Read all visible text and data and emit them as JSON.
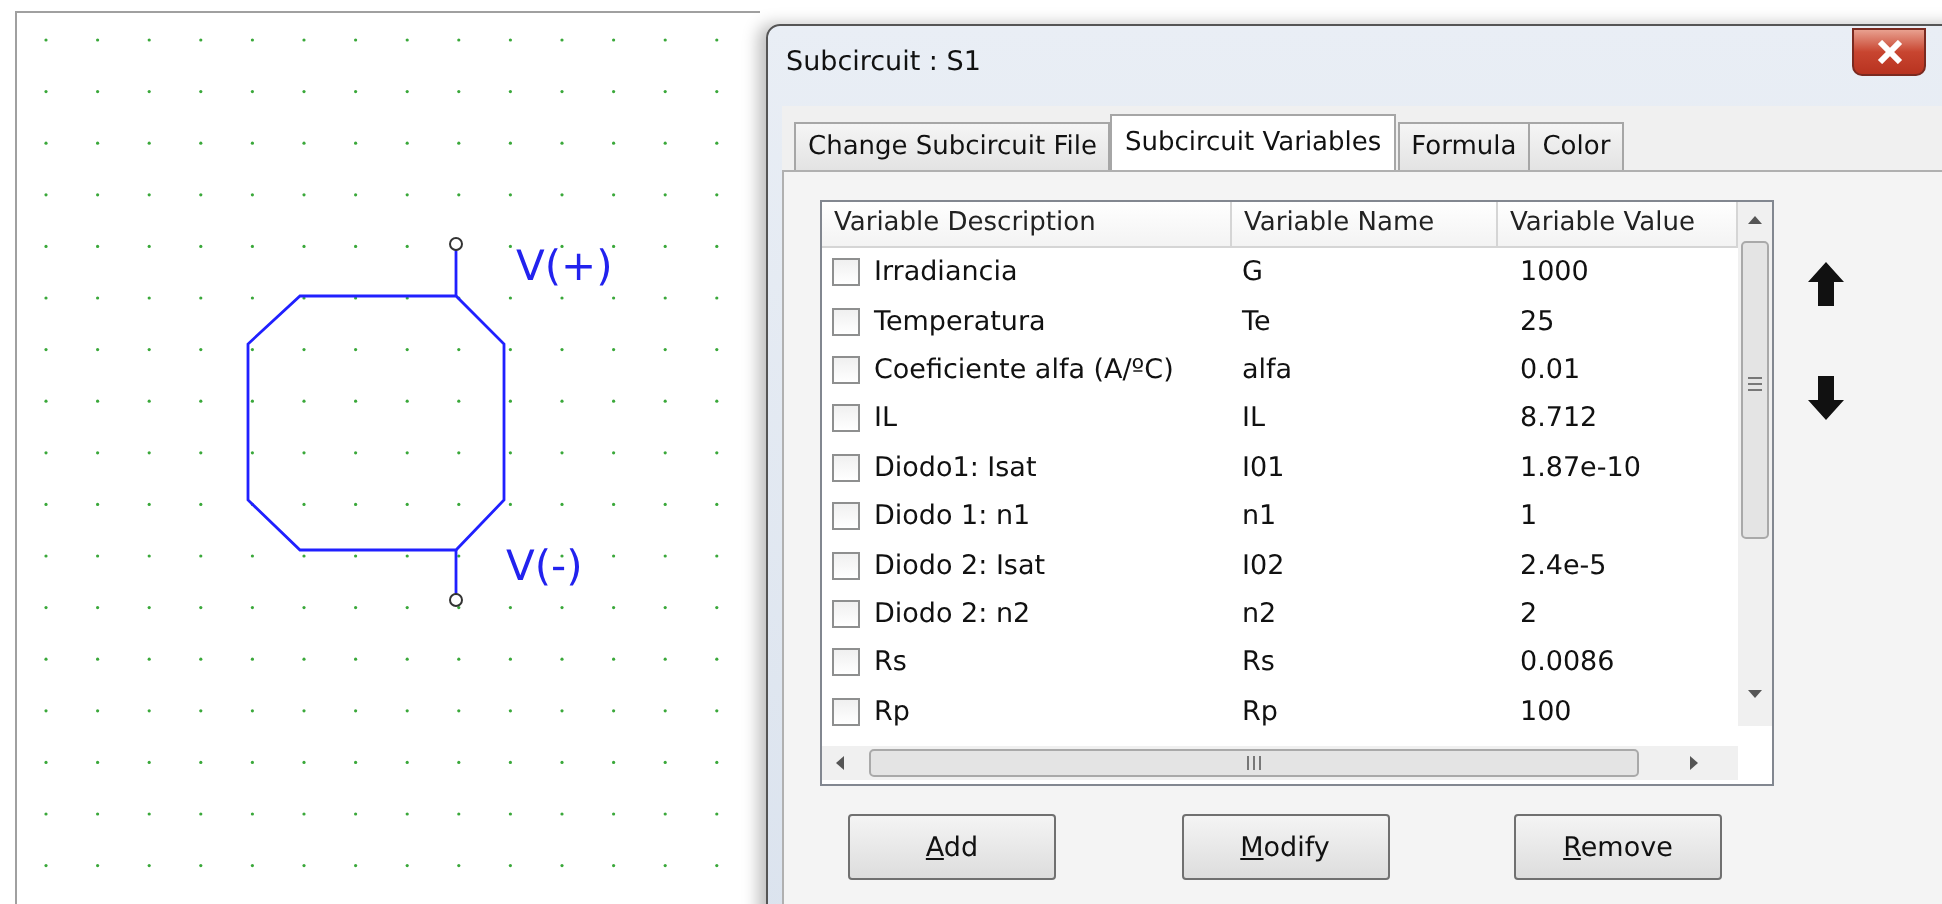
{
  "canvas": {
    "pins": [
      {
        "label": "V(+)"
      },
      {
        "label": "V(-)"
      }
    ]
  },
  "dialog": {
    "title": "Subcircuit : S1",
    "tabs": [
      {
        "label": "Change Subcircuit File",
        "selected": false
      },
      {
        "label": "Subcircuit Variables",
        "selected": true
      },
      {
        "label": "Formula",
        "selected": false
      },
      {
        "label": "Color",
        "selected": false
      }
    ],
    "table": {
      "columns": [
        "Variable Description",
        "Variable Name",
        "Variable Value"
      ],
      "rows": [
        {
          "checked": false,
          "description": "Irradiancia",
          "name": "G",
          "value": "1000"
        },
        {
          "checked": false,
          "description": "Temperatura",
          "name": "Te",
          "value": "25"
        },
        {
          "checked": false,
          "description": "Coeficiente alfa (A/ºC)",
          "name": "alfa",
          "value": "0.01"
        },
        {
          "checked": false,
          "description": "IL",
          "name": "IL",
          "value": "8.712"
        },
        {
          "checked": false,
          "description": "Diodo1: Isat",
          "name": "I01",
          "value": "1.87e-10"
        },
        {
          "checked": false,
          "description": "Diodo 1: n1",
          "name": "n1",
          "value": "1"
        },
        {
          "checked": false,
          "description": "Diodo 2: Isat",
          "name": "I02",
          "value": "2.4e-5"
        },
        {
          "checked": false,
          "description": "Diodo 2: n2",
          "name": "n2",
          "value": "2"
        },
        {
          "checked": false,
          "description": "Rs",
          "name": "Rs",
          "value": "0.0086"
        },
        {
          "checked": false,
          "description": "Rp",
          "name": "Rp",
          "value": "100"
        }
      ]
    },
    "buttons": [
      "Add",
      "Modify",
      "Remove"
    ]
  }
}
